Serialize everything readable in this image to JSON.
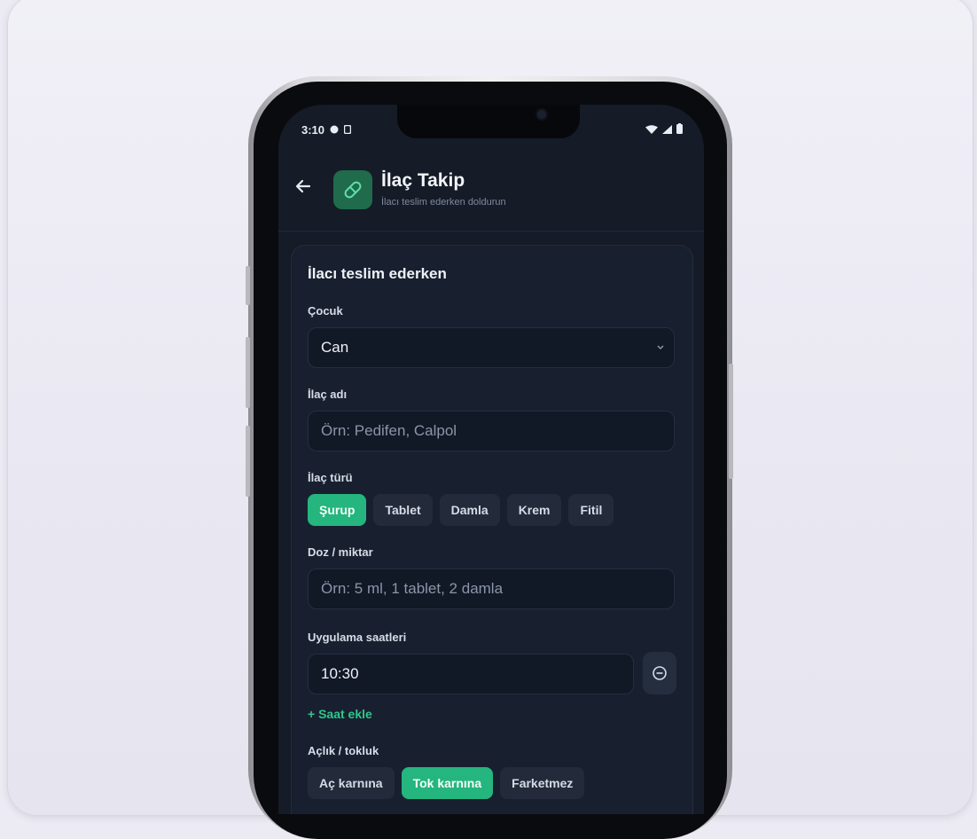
{
  "status_bar": {
    "time": "3:10"
  },
  "header": {
    "back_icon": "arrow-left-icon",
    "app_icon": "pill-icon",
    "title": "İlaç Takip",
    "subtitle": "İlacı teslim ederken doldurun"
  },
  "form": {
    "card_title": "İlacı teslim ederken",
    "child": {
      "label": "Çocuk",
      "value": "Can"
    },
    "medicine_name": {
      "label": "İlaç adı",
      "placeholder": "Örn: Pedifen, Calpol"
    },
    "medicine_type": {
      "label": "İlaç türü",
      "options": [
        "Şurup",
        "Tablet",
        "Damla",
        "Krem",
        "Fitil"
      ],
      "selected": "Şurup"
    },
    "dose": {
      "label": "Doz / miktar",
      "placeholder": "Örn: 5 ml, 1 tablet, 2 damla"
    },
    "times": {
      "label": "Uygulama saatleri",
      "value": "10:30",
      "add_label": "Saat ekle"
    },
    "hunger": {
      "label": "Açlık / tokluk",
      "options": [
        "Aç karnına",
        "Tok karnına",
        "Farketmez"
      ],
      "selected": "Tok karnına"
    }
  },
  "colors": {
    "accent": "#25b57e",
    "background": "#151b27",
    "card": "#182030"
  }
}
